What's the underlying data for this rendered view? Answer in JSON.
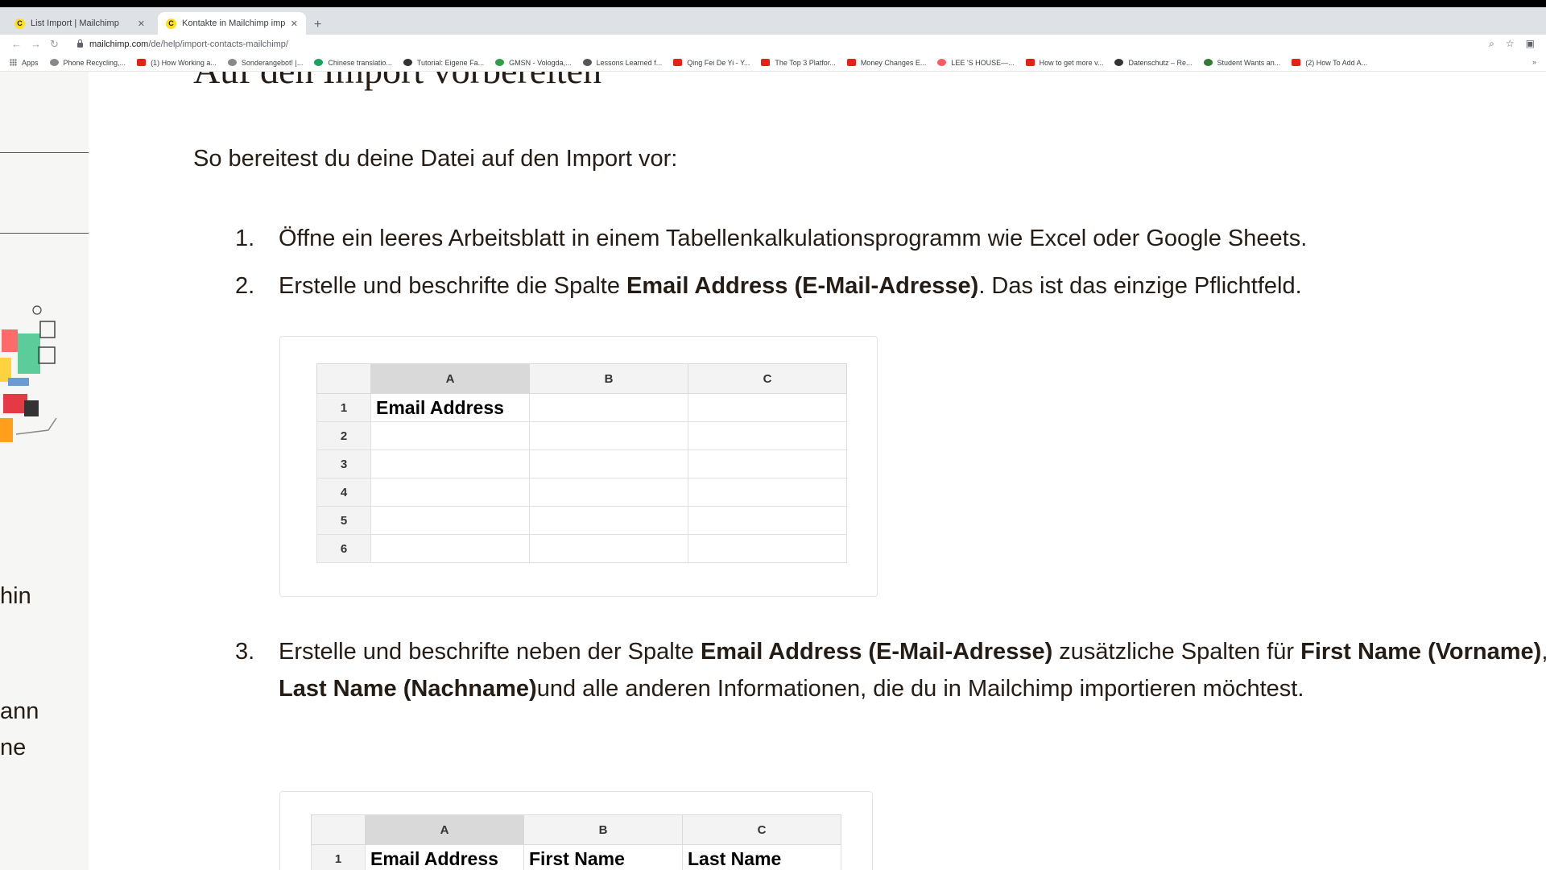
{
  "browser": {
    "tabs": [
      {
        "title": "List Import | Mailchimp",
        "favicon": "mailchimp-icon",
        "active": false
      },
      {
        "title": "Kontakte in Mailchimp importi...",
        "favicon": "mailchimp-icon",
        "active": true
      }
    ],
    "new_tab": "+",
    "url_host": "mailchimp.com",
    "url_path": "/de/help/import-contacts-mailchimp/",
    "bookmarks": [
      {
        "label": "Apps",
        "icon": "apps-icon"
      },
      {
        "label": "Phone Recycling,...",
        "icon": "search-icon"
      },
      {
        "label": "(1) How Working a...",
        "icon": "youtube-icon",
        "color": "#e62117"
      },
      {
        "label": "Sonderangebot! |...",
        "icon": "site-icon",
        "color": "#888888"
      },
      {
        "label": "Chinese translatio...",
        "icon": "site-icon",
        "color": "#1aa260"
      },
      {
        "label": "Tutorial: Eigene Fa...",
        "icon": "hash-icon",
        "color": "#333333"
      },
      {
        "label": "GMSN - Vologda,...",
        "icon": "site-icon",
        "color": "#2ea043"
      },
      {
        "label": "Lessons Learned f...",
        "icon": "site-icon",
        "color": "#555555"
      },
      {
        "label": "Qing Fei De Yi - Y...",
        "icon": "youtube-icon",
        "color": "#e62117"
      },
      {
        "label": "The Top 3 Platfor...",
        "icon": "youtube-icon",
        "color": "#e62117"
      },
      {
        "label": "Money Changes E...",
        "icon": "youtube-icon",
        "color": "#e62117"
      },
      {
        "label": "LEE 'S HOUSE—...",
        "icon": "airbnb-icon",
        "color": "#ff5a5f"
      },
      {
        "label": "How to get more v...",
        "icon": "youtube-icon",
        "color": "#e62117"
      },
      {
        "label": "Datenschutz – Re...",
        "icon": "site-icon",
        "color": "#333333"
      },
      {
        "label": "Student Wants an...",
        "icon": "site-icon",
        "color": "#2e7d32"
      },
      {
        "label": "(2) How To Add A...",
        "icon": "youtube-icon",
        "color": "#e62117"
      }
    ],
    "bookmarks_more": "»"
  },
  "page": {
    "heading_partial": "Auf den Import vorbereiten",
    "intro": "So bereitest du deine Datei auf den Import vor:",
    "steps": [
      {
        "num": "1.",
        "parts": [
          {
            "t": "Öffne ein leeres Arbeitsblatt in einem Tabellenkalkulationsprogramm wie Excel oder Google Sheets.",
            "b": false
          }
        ]
      },
      {
        "num": "2.",
        "parts": [
          {
            "t": "Erstelle und beschrifte die Spalte ",
            "b": false
          },
          {
            "t": "Email Address (E-Mail-Adresse)",
            "b": true
          },
          {
            "t": ". Das ist das einzige Pflichtfeld.",
            "b": false
          }
        ]
      },
      {
        "num": "3.",
        "parts": [
          {
            "t": "Erstelle und beschrifte neben der Spalte ",
            "b": false
          },
          {
            "t": "Email Address (E-Mail-Adresse)",
            "b": true
          },
          {
            "t": " zusätzliche Spalten für ",
            "b": false
          },
          {
            "t": "First Name (Vorname)",
            "b": true
          },
          {
            "t": ", ",
            "b": false
          },
          {
            "t": "Last Name (Nachname)",
            "b": true
          },
          {
            "t": "und alle anderen Informationen, die du in Mailchimp importieren möchtest.",
            "b": false
          }
        ]
      }
    ],
    "sidebar_fragments": [
      "hin",
      "ann",
      "ne"
    ],
    "sheet1": {
      "columns": [
        "A",
        "B",
        "C"
      ],
      "rows": [
        [
          "1",
          "Email Address",
          "",
          ""
        ],
        [
          "2",
          "",
          "",
          ""
        ],
        [
          "3",
          "",
          "",
          ""
        ],
        [
          "4",
          "",
          "",
          ""
        ],
        [
          "5",
          "",
          "",
          ""
        ],
        [
          "6",
          "",
          "",
          ""
        ]
      ]
    },
    "sheet2": {
      "columns": [
        "A",
        "B",
        "C"
      ],
      "rows": [
        [
          "1",
          "Email Address",
          "First Name",
          "Last Name"
        ]
      ]
    }
  }
}
